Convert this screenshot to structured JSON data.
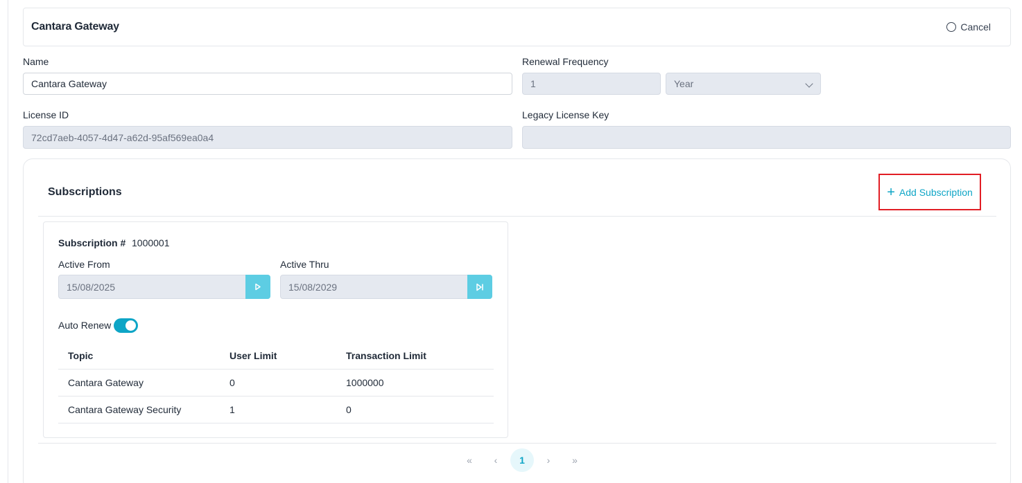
{
  "header": {
    "title": "Cantara Gateway",
    "cancel_label": "Cancel"
  },
  "form": {
    "name_label": "Name",
    "name_value": "Cantara Gateway",
    "renewal_label": "Renewal Frequency",
    "renewal_number": "1",
    "renewal_unit": "Year",
    "license_id_label": "License ID",
    "license_id_value": "72cd7aeb-4057-4d47-a62d-95af569ea0a4",
    "legacy_key_label": "Legacy License Key",
    "legacy_key_value": ""
  },
  "subscriptions": {
    "title": "Subscriptions",
    "add_label": "Add Subscription",
    "items": [
      {
        "number_label": "Subscription #",
        "number": "1000001",
        "active_from_label": "Active From",
        "active_from": "15/08/2025",
        "active_thru_label": "Active Thru",
        "active_thru": "15/08/2029",
        "auto_renew_label": "Auto Renew",
        "auto_renew": true,
        "table": {
          "headers": [
            "Topic",
            "User Limit",
            "Transaction Limit"
          ],
          "rows": [
            [
              "Cantara Gateway",
              "0",
              "1000000"
            ],
            [
              "Cantara Gateway Security",
              "1",
              "0"
            ]
          ]
        }
      }
    ]
  },
  "pagination": {
    "first": "«",
    "prev": "‹",
    "current": "1",
    "next": "›",
    "last": "»"
  },
  "colors": {
    "accent": "#0ea5c6",
    "highlight_border": "#e11d24",
    "disabled_bg": "#e5e9f0"
  }
}
